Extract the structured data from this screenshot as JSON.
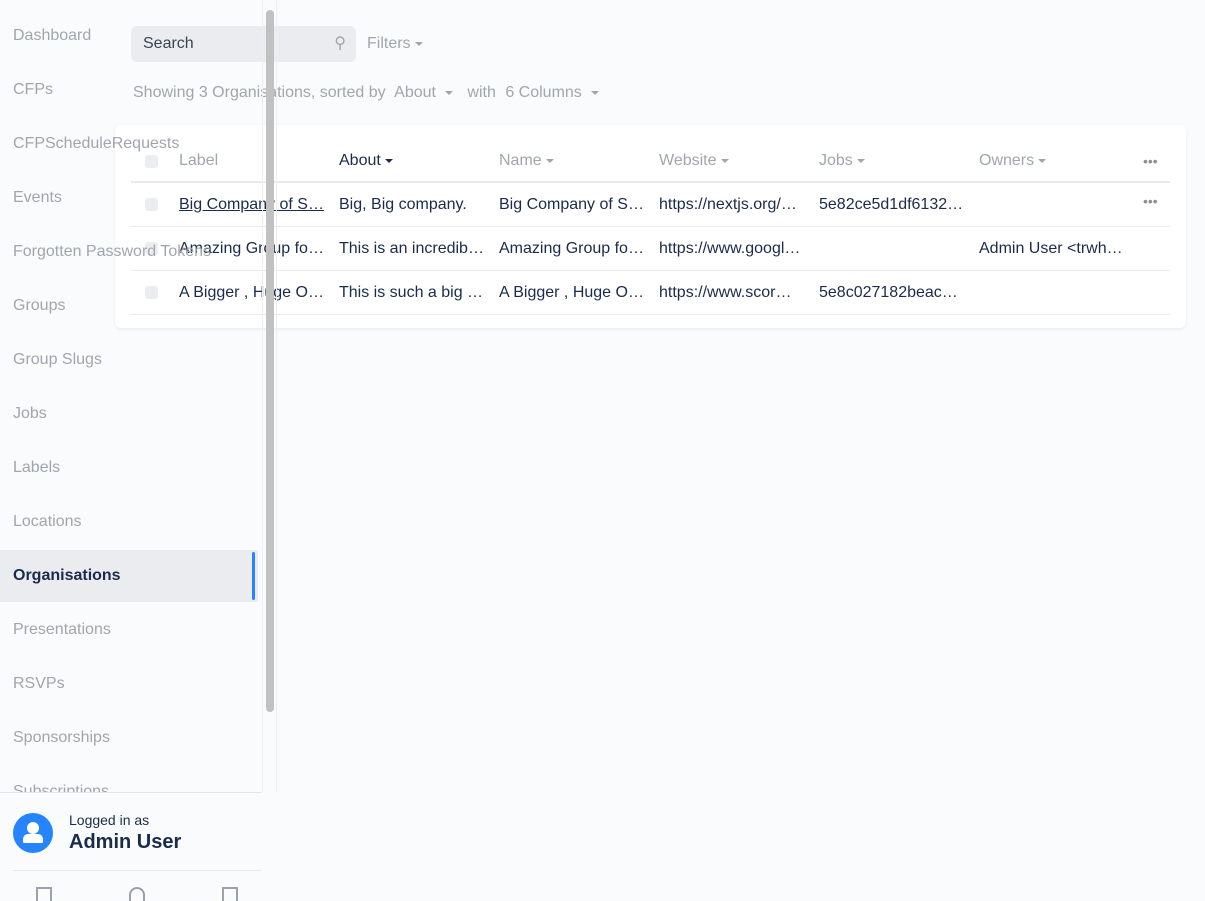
{
  "sidebar": {
    "items": [
      {
        "label": "Dashboard"
      },
      {
        "label": "CFPs"
      },
      {
        "label": "CFPScheduleRequests"
      },
      {
        "label": "Events"
      },
      {
        "label": "Forgotten Password Tokens"
      },
      {
        "label": "Groups"
      },
      {
        "label": "Group Slugs"
      },
      {
        "label": "Jobs"
      },
      {
        "label": "Labels"
      },
      {
        "label": "Locations"
      },
      {
        "label": "Organisations",
        "active": true
      },
      {
        "label": "Presentations"
      },
      {
        "label": "RSVPs"
      },
      {
        "label": "Sponsorships"
      },
      {
        "label": "Subscriptions"
      }
    ],
    "footer": {
      "logged_in_as": "Logged in as",
      "user_name": "Admin User",
      "icons": [
        "sign-out-icon",
        "github-icon",
        "terminal-icon"
      ]
    }
  },
  "toolbar": {
    "search_placeholder": "Search",
    "filters_label": "Filters"
  },
  "summary": {
    "showing": "Showing 3 Organisations, sorted by",
    "sort_field": "About",
    "with": "with",
    "columns": "6 Columns"
  },
  "table": {
    "columns": [
      "Label",
      "About",
      "Name",
      "Website",
      "Jobs",
      "Owners"
    ],
    "sorted_column": "About",
    "rows": [
      [
        "Big Company of S…",
        "Big, Big company.",
        "Big Company of S…",
        "https://nextjs.org/…",
        "5e82ce5d1df6132…",
        ""
      ],
      [
        "Amazing Group fo…",
        "This is an incredib…",
        "Amazing Group fo…",
        "https://www.googl…",
        "",
        "Admin User <trwh…"
      ],
      [
        "A Bigger , Huge O…",
        "This is such a big …",
        "A Bigger , Huge O…",
        "https://www.scor…",
        "5e8c027182beac…",
        ""
      ]
    ]
  },
  "colors": {
    "accent": "#2684ff",
    "text": "#1a2b4b",
    "muted": "#a0a6ae"
  }
}
